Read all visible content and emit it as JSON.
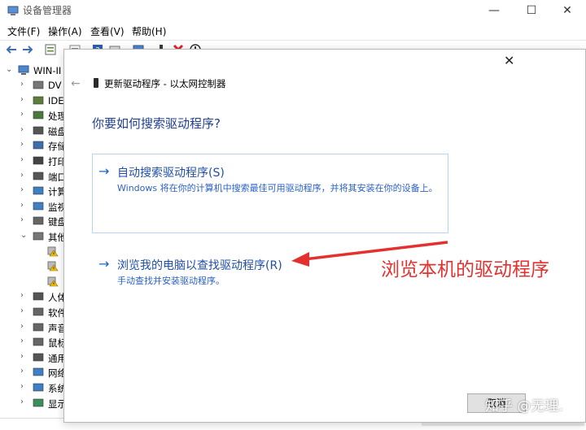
{
  "window": {
    "title": "设备管理器",
    "minimize_glyph": "—",
    "maximize_glyph": "☐",
    "close_glyph": "✕"
  },
  "menubar": {
    "items": [
      "文件(F)",
      "操作(A)",
      "查看(V)",
      "帮助(H)"
    ]
  },
  "toolbar": {
    "icons": [
      "back-arrow-icon",
      "forward-arrow-icon",
      "properties-icon",
      "help-icon",
      "device-list-icon",
      "monitor-icon",
      "update-driver-icon",
      "uninstall-x-icon",
      "scan-icon"
    ]
  },
  "tree": {
    "root": "WIN-II",
    "items": [
      {
        "label": "DV",
        "icon": "dvd-drive-icon",
        "expanded": false
      },
      {
        "label": "IDE",
        "icon": "ide-controller-icon",
        "expanded": false
      },
      {
        "label": "处理",
        "icon": "processor-icon",
        "expanded": false
      },
      {
        "label": "磁盘",
        "icon": "disk-drive-icon",
        "expanded": false
      },
      {
        "label": "存储",
        "icon": "storage-icon",
        "expanded": false
      },
      {
        "label": "打印",
        "icon": "printer-icon",
        "expanded": false
      },
      {
        "label": "端口",
        "icon": "port-icon",
        "expanded": false
      },
      {
        "label": "计算",
        "icon": "computer-icon",
        "expanded": false
      },
      {
        "label": "监视",
        "icon": "monitor-icon",
        "expanded": false
      },
      {
        "label": "键盘",
        "icon": "keyboard-icon",
        "expanded": false
      },
      {
        "label": "其他",
        "icon": "other-devices-icon",
        "expanded": true
      },
      {
        "label": "",
        "icon": "warning-device-icon",
        "child": true
      },
      {
        "label": "",
        "icon": "warning-device-icon",
        "child": true
      },
      {
        "label": "",
        "icon": "warning-device-icon",
        "child": true
      },
      {
        "label": "人体",
        "icon": "hid-icon",
        "expanded": false
      },
      {
        "label": "软件",
        "icon": "software-icon",
        "expanded": false
      },
      {
        "label": "声音",
        "icon": "sound-icon",
        "expanded": false
      },
      {
        "label": "鼠标",
        "icon": "mouse-icon",
        "expanded": false
      },
      {
        "label": "通用",
        "icon": "usb-icon",
        "expanded": false
      },
      {
        "label": "网络",
        "icon": "network-icon",
        "expanded": false
      },
      {
        "label": "系统",
        "icon": "system-icon",
        "expanded": false
      },
      {
        "label": "显示",
        "icon": "display-adapter-icon",
        "expanded": false
      }
    ]
  },
  "dialog": {
    "close_glyph": "✕",
    "back_glyph": "←",
    "title": "更新驱动程序 - 以太网控制器",
    "question": "你要如何搜索驱动程序?",
    "options": [
      {
        "arrow": "→",
        "title": "自动搜索驱动程序(S)",
        "description": "Windows 将在你的计算机中搜索最佳可用驱动程序，并将其安装在你的设备上。"
      },
      {
        "arrow": "→",
        "title": "浏览我的电脑以查找驱动程序(R)",
        "description": "手动查找并安装驱动程序。"
      }
    ],
    "cancel_label": "取消"
  },
  "annotation": {
    "text": "浏览本机的驱动程序",
    "color": "#e53030"
  },
  "watermark": "知乎 @无理.",
  "colors": {
    "link_blue": "#1f4fa8",
    "question_blue": "#1f3f8f",
    "option_border": "#b7d5f0",
    "annotation_red": "#e53030"
  }
}
